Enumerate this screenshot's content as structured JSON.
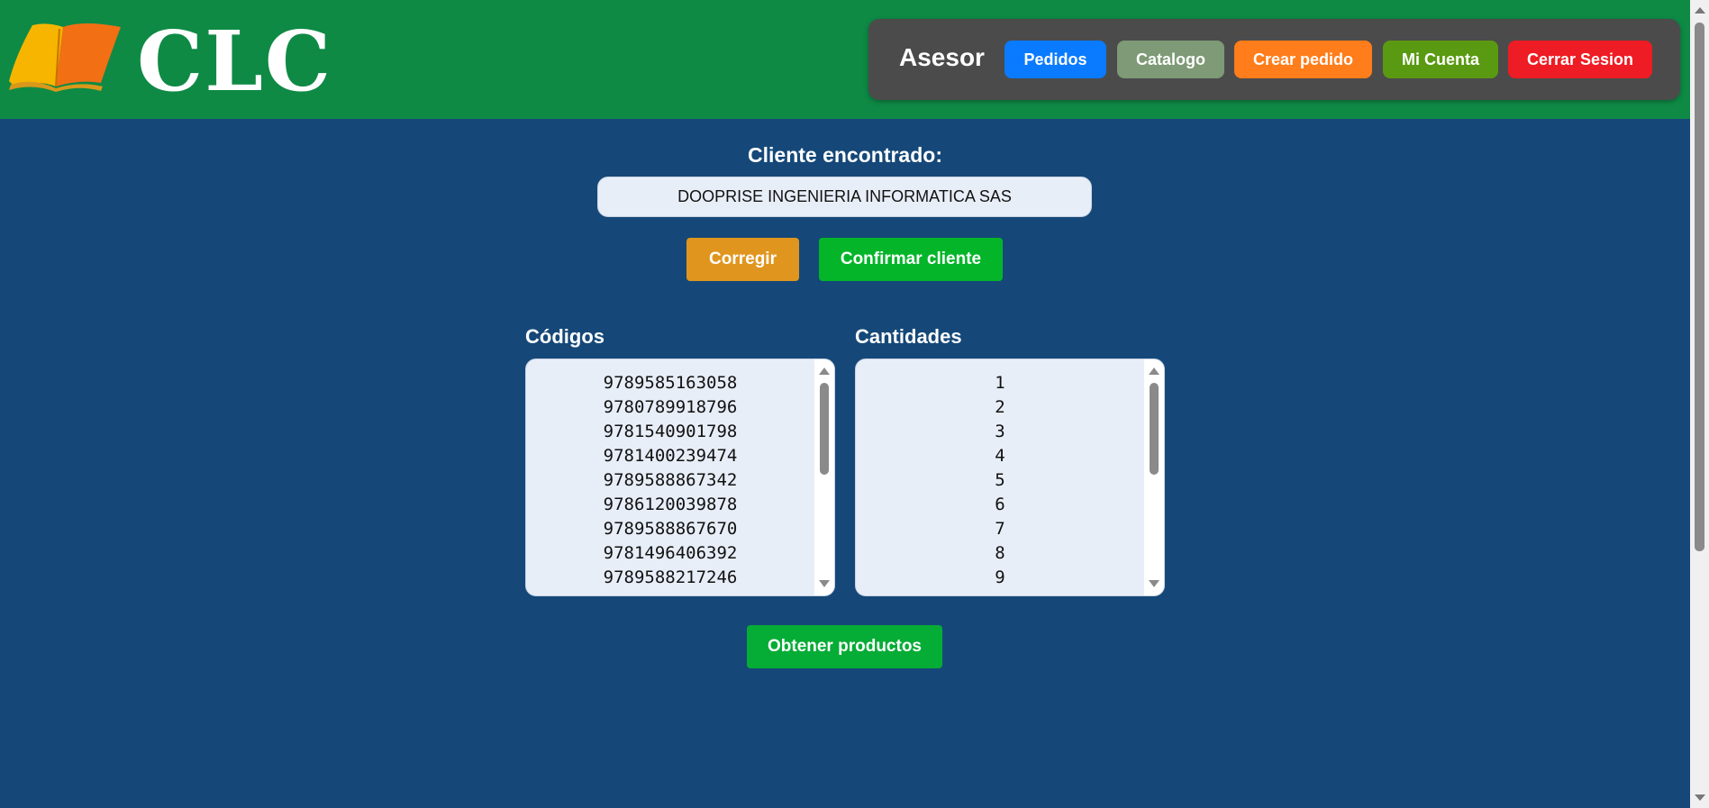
{
  "header": {
    "logo_text": "CLC",
    "logo_icon": "open-book-icon",
    "role": "Asesor",
    "nav": {
      "pedidos": "Pedidos",
      "catalogo": "Catalogo",
      "crear_pedido": "Crear pedido",
      "mi_cuenta": "Mi Cuenta",
      "cerrar_sesion": "Cerrar Sesion"
    }
  },
  "cliente": {
    "label": "Cliente encontrado:",
    "value": "DOOPRISE INGENIERIA INFORMATICA SAS",
    "corregir_label": "Corregir",
    "confirmar_label": "Confirmar cliente"
  },
  "codigos": {
    "label": "Códigos",
    "items": [
      "9789585163058",
      "9780789918796",
      "9781540901798",
      "9781400239474",
      "9789588867342",
      "9786120039878",
      "9789588867670",
      "9781496406392",
      "9789588217246"
    ]
  },
  "cantidades": {
    "label": "Cantidades",
    "items": [
      "1",
      "2",
      "3",
      "4",
      "5",
      "6",
      "7",
      "8",
      "9"
    ]
  },
  "obtener_label": "Obtener productos",
  "colors": {
    "header_bg": "#0e8a45",
    "page_bg": "#154878",
    "nav_bg": "#4b4b4b",
    "pedidos": "#0a7bff",
    "catalogo": "#7e9a76",
    "crear_pedido": "#ff7d1a",
    "mi_cuenta": "#5a9a12",
    "cerrar_sesion": "#ee1c24",
    "corregir": "#e0961e",
    "confirmar": "#04b52a",
    "obtener": "#05ac35"
  }
}
